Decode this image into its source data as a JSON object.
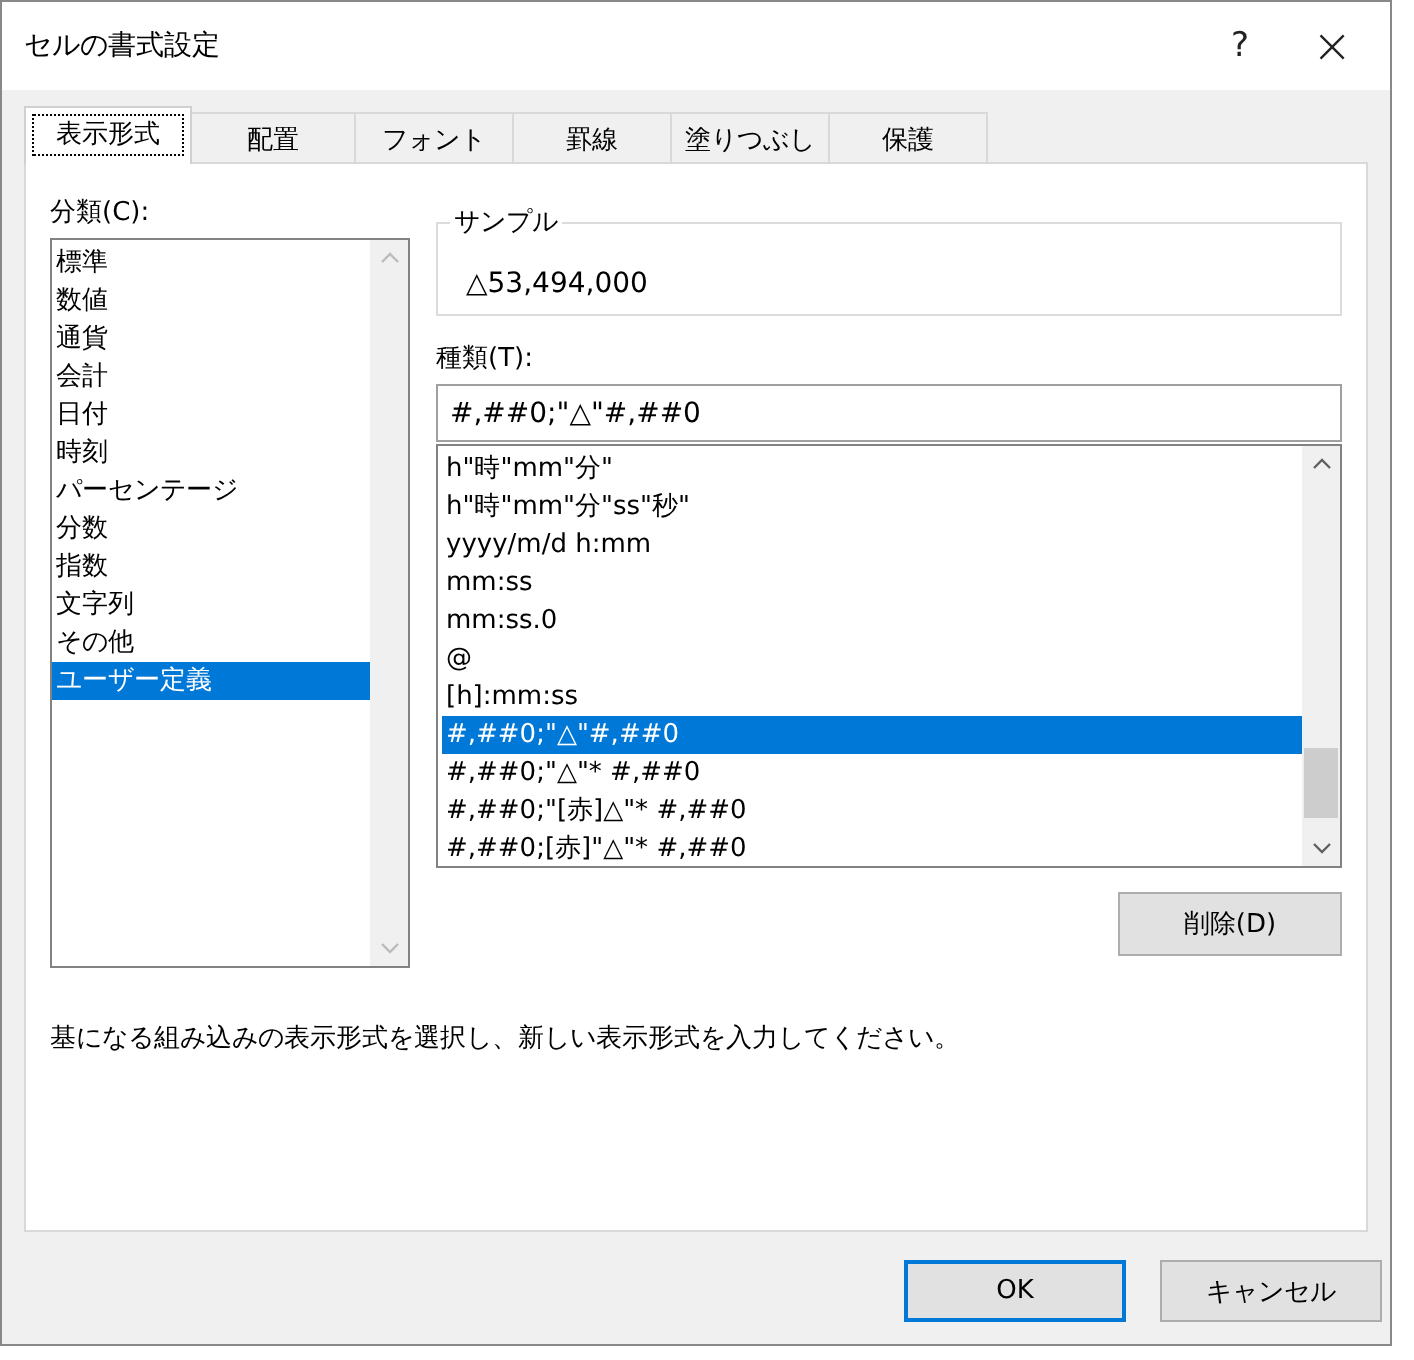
{
  "window": {
    "title": "セルの書式設定",
    "help": "?",
    "close": "×"
  },
  "tabs": [
    {
      "label": "表示形式",
      "selected": true
    },
    {
      "label": "配置",
      "selected": false
    },
    {
      "label": "フォント",
      "selected": false
    },
    {
      "label": "罫線",
      "selected": false
    },
    {
      "label": "塗りつぶし",
      "selected": false
    },
    {
      "label": "保護",
      "selected": false
    }
  ],
  "category": {
    "label": "分類(C):",
    "items": [
      {
        "label": "標準",
        "selected": false
      },
      {
        "label": "数値",
        "selected": false
      },
      {
        "label": "通貨",
        "selected": false
      },
      {
        "label": "会計",
        "selected": false
      },
      {
        "label": "日付",
        "selected": false
      },
      {
        "label": "時刻",
        "selected": false
      },
      {
        "label": "パーセンテージ",
        "selected": false
      },
      {
        "label": "分数",
        "selected": false
      },
      {
        "label": "指数",
        "selected": false
      },
      {
        "label": "文字列",
        "selected": false
      },
      {
        "label": "その他",
        "selected": false
      },
      {
        "label": "ユーザー定義",
        "selected": true
      }
    ]
  },
  "sample": {
    "label": "サンプル",
    "value": "△53,494,000"
  },
  "type": {
    "label": "種類(T):",
    "value": "#,##0;\"△\"#,##0",
    "items": [
      {
        "label": "h\"時\"mm\"分\"",
        "selected": false
      },
      {
        "label": "h\"時\"mm\"分\"ss\"秒\"",
        "selected": false
      },
      {
        "label": "yyyy/m/d h:mm",
        "selected": false
      },
      {
        "label": "mm:ss",
        "selected": false
      },
      {
        "label": "mm:ss.0",
        "selected": false
      },
      {
        "label": "@",
        "selected": false
      },
      {
        "label": "[h]:mm:ss",
        "selected": false
      },
      {
        "label": "#,##0;\"△\"#,##0",
        "selected": true
      },
      {
        "label": "#,##0;\"△\"* #,##0",
        "selected": false
      },
      {
        "label": "#,##0;\"[赤]△\"* #,##0",
        "selected": false
      },
      {
        "label": "#,##0;[赤]\"△\"* #,##0",
        "selected": false
      }
    ]
  },
  "delete_button": "削除(D)",
  "description": "基になる組み込みの表示形式を選択し、新しい表示形式を入力してください。",
  "buttons": [
    {
      "label": "OK",
      "default": true
    },
    {
      "label": "キャンセル",
      "default": false
    }
  ]
}
